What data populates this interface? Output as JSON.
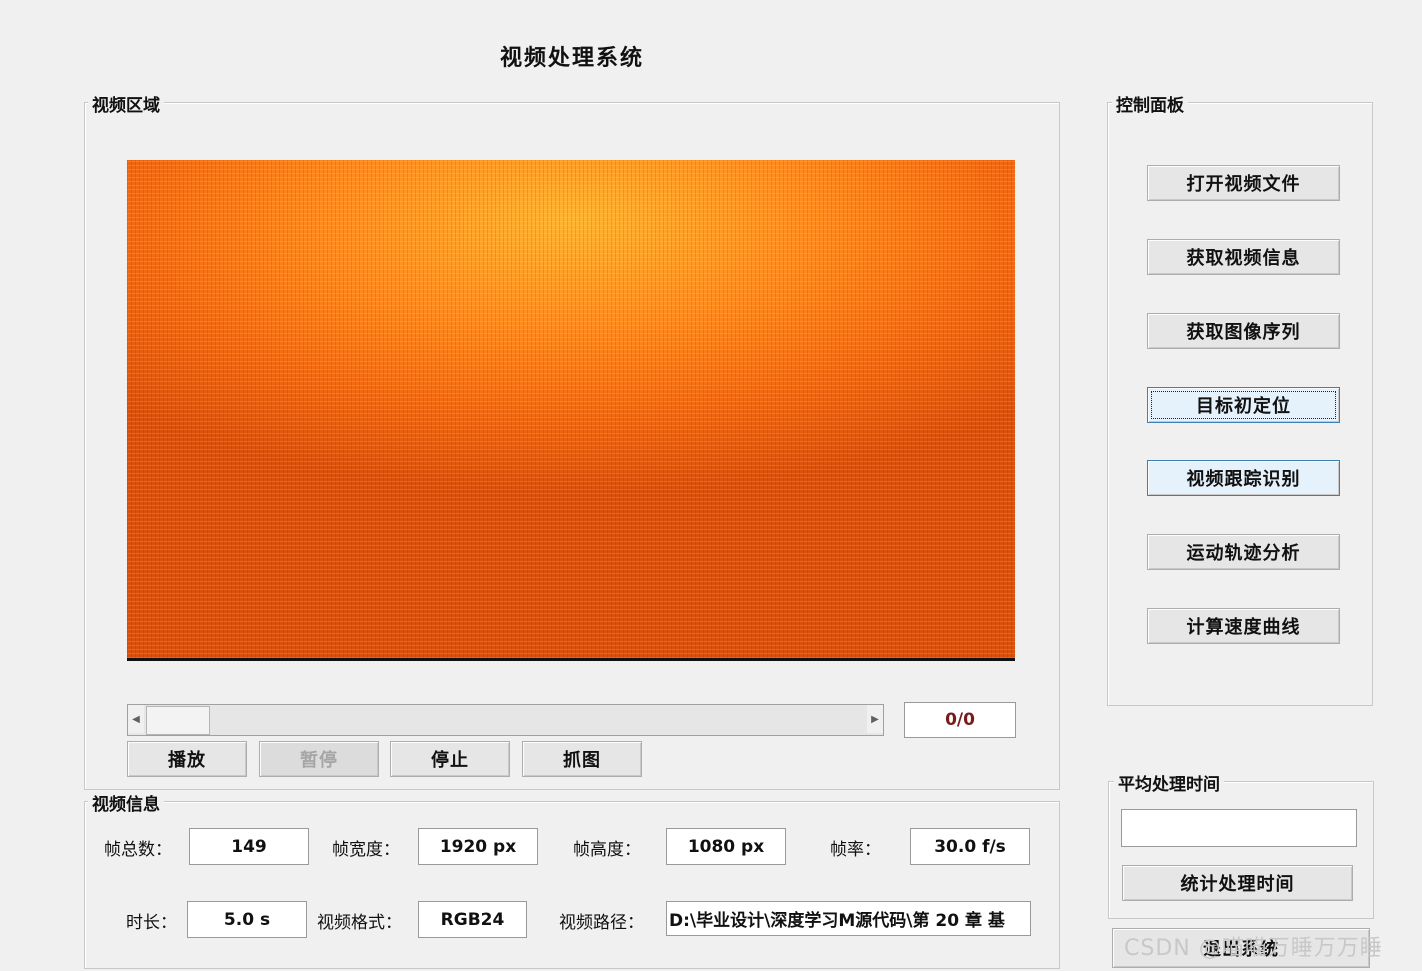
{
  "app": {
    "title": "视频处理系统"
  },
  "video_area": {
    "label": "视频区域"
  },
  "frame_counter": "0/0",
  "playback": {
    "play": "播放",
    "pause": "暂停",
    "stop": "停止",
    "capture": "抓图"
  },
  "control_panel": {
    "label": "控制面板",
    "buttons": [
      "打开视频文件",
      "获取视频信息",
      "获取图像序列",
      "目标初定位",
      "视频跟踪识别",
      "运动轨迹分析",
      "计算速度曲线"
    ]
  },
  "avg_time": {
    "label": "平均处理时间",
    "value": "",
    "button": "统计处理时间"
  },
  "exit_button": "退出系统",
  "video_info": {
    "label": "视频信息",
    "total_frames_label": "帧总数：",
    "total_frames": "149",
    "width_label": "帧宽度：",
    "width": "1920 px",
    "height_label": "帧高度：",
    "height": "1080 px",
    "fps_label": "帧率：",
    "fps": "30.0 f/s",
    "duration_label": "时长：",
    "duration": "5.0 s",
    "format_label": "视频格式：",
    "format": "RGB24",
    "path_label": "视频路径：",
    "path": "D:\\毕业设计\\深度学习M源代码\\第 20 章 基"
  },
  "watermark": "CSDN @喵喵万睡万万睡"
}
